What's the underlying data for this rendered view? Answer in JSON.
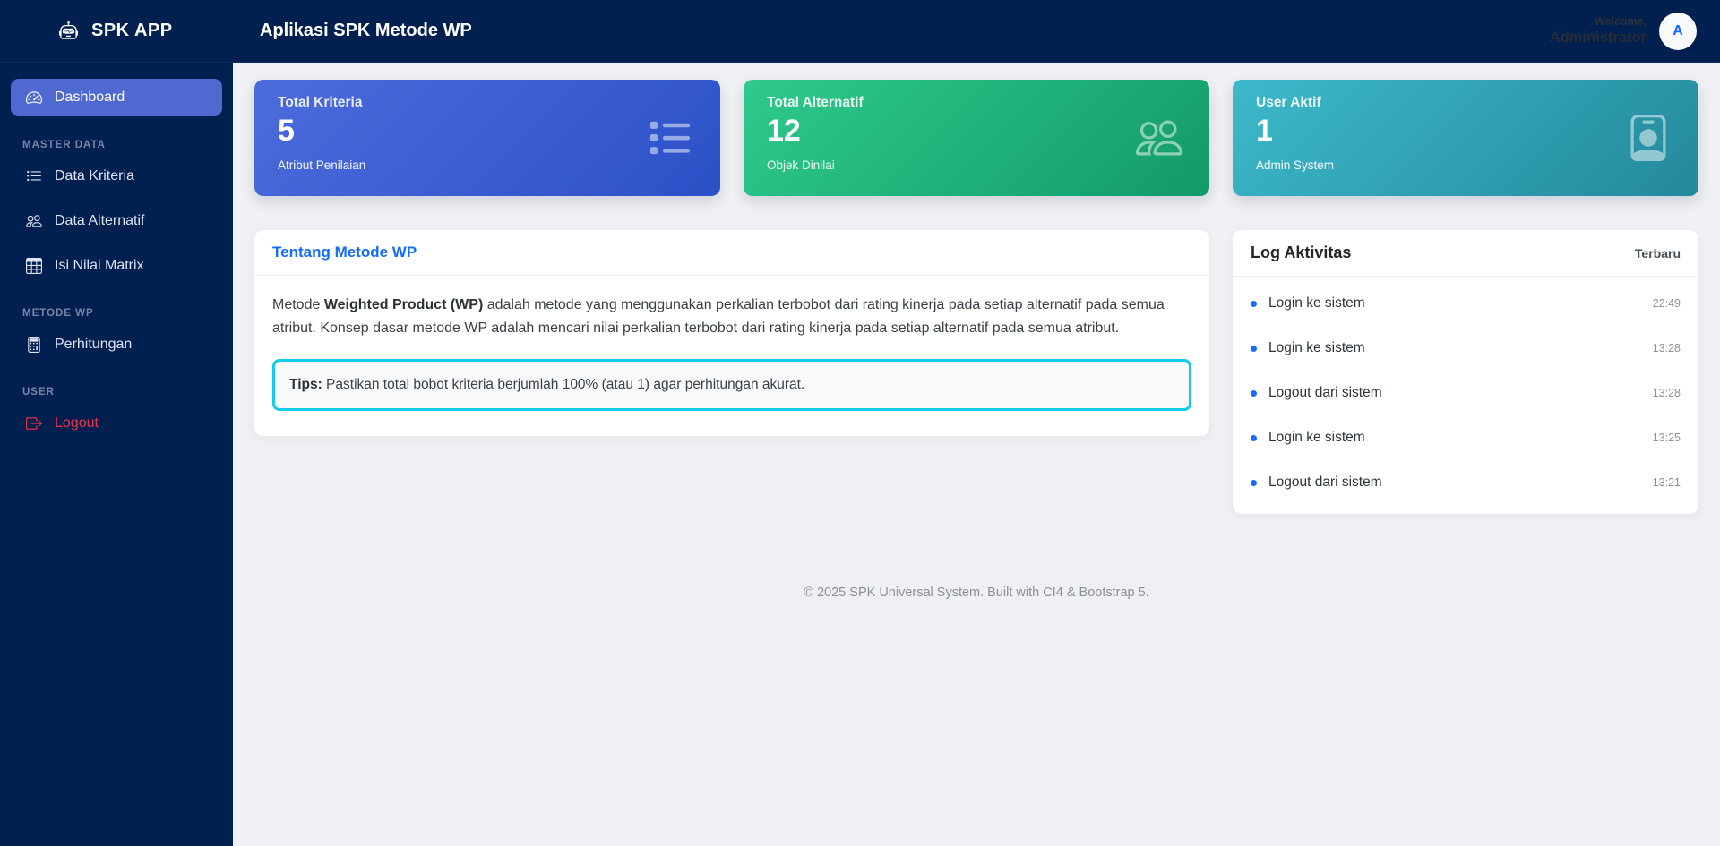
{
  "app": {
    "brand": "SPK APP",
    "page_title": "Aplikasi SPK Metode WP",
    "welcome_label": "Welcome,",
    "username": "Administrator",
    "avatar_initial": "A"
  },
  "sidebar": {
    "sections": [
      {
        "items": [
          {
            "label": "Dashboard",
            "icon": "speedometer-icon",
            "active": true
          }
        ]
      },
      {
        "header": "MASTER DATA",
        "items": [
          {
            "label": "Data Kriteria",
            "icon": "list-ul-icon"
          },
          {
            "label": "Data Alternatif",
            "icon": "people-icon"
          },
          {
            "label": "Isi Nilai Matrix",
            "icon": "table-grid-icon"
          }
        ]
      },
      {
        "header": "METODE WP",
        "items": [
          {
            "label": "Perhitungan",
            "icon": "calculator-icon"
          }
        ]
      },
      {
        "header": "USER",
        "items": [
          {
            "label": "Logout",
            "icon": "logout-icon",
            "danger": true
          }
        ]
      }
    ]
  },
  "stats": [
    {
      "title": "Total Kriteria",
      "value": "5",
      "subtitle": "Atribut Penilaian",
      "icon": "list-icon",
      "gradient": [
        "#4d6cdc",
        "#2b50c7"
      ]
    },
    {
      "title": "Total Alternatif",
      "value": "12",
      "subtitle": "Objek Dinilai",
      "icon": "people-icon",
      "gradient": [
        "#2fca8c",
        "#129a69"
      ]
    },
    {
      "title": "User Aktif",
      "value": "1",
      "subtitle": "Admin System",
      "icon": "person-badge-icon",
      "gradient": [
        "#3db9cb",
        "#23899b"
      ]
    }
  ],
  "about": {
    "title": "Tentang Metode WP",
    "body_prefix": "Metode ",
    "body_bold": "Weighted Product (WP)",
    "body_rest": " adalah metode yang menggunakan perkalian terbobot dari rating kinerja pada setiap alternatif pada semua atribut. Konsep dasar metode WP adalah mencari nilai perkalian terbobot dari rating kinerja pada setiap alternatif pada semua atribut.",
    "tip_label": "Tips:",
    "tip_text": " Pastikan total bobot kriteria berjumlah 100% (atau 1) agar perhitungan akurat."
  },
  "activity": {
    "title": "Log Aktivitas",
    "badge": "Terbaru",
    "items": [
      {
        "text": "Login ke sistem",
        "time": "22:49"
      },
      {
        "text": "Login ke sistem",
        "time": "13:28"
      },
      {
        "text": "Logout dari sistem",
        "time": "13:28"
      },
      {
        "text": "Login ke sistem",
        "time": "13:25"
      },
      {
        "text": "Logout dari sistem",
        "time": "13:21"
      }
    ]
  },
  "footer": {
    "text": "© 2025 SPK Universal System. Built with CI4 & Bootstrap 5."
  },
  "colors": {
    "navbar_bg": "#02204f",
    "sidebar_active": "#5069d1",
    "accent_blue": "#156cf7",
    "tips_border": "#13cbe9",
    "danger": "#e8354b",
    "log_dot": "#1a6ef5",
    "card_blue_gradient": [
      "#4d6cdc",
      "#2b50c7"
    ],
    "card_green_gradient": [
      "#2fca8c",
      "#129a69"
    ],
    "card_teal_gradient": [
      "#3db9cb",
      "#23899b"
    ],
    "page_bg": "#eef0f3"
  }
}
